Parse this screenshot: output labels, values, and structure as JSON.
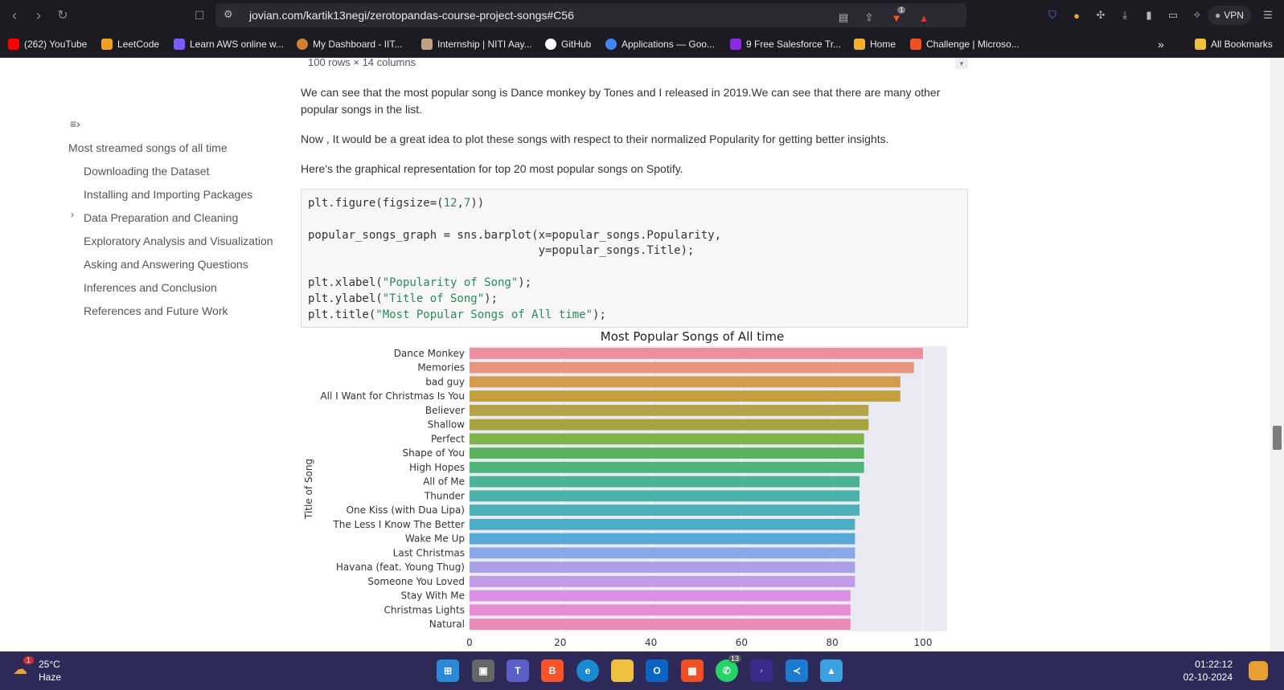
{
  "browser": {
    "url": "jovian.com/kartik13negi/zerotopandas-course-project-songs#C56",
    "vpn_label": "VPN",
    "shield_badge": "1"
  },
  "bookmarks": [
    {
      "label": "(262) YouTube",
      "color": "#ff0000"
    },
    {
      "label": "LeetCode",
      "color": "#f0a020"
    },
    {
      "label": "Learn AWS online w...",
      "color": "#7a5cff"
    },
    {
      "label": "My Dashboard - IIT...",
      "color": "#d08030"
    },
    {
      "label": "Internship | NITI Aay...",
      "color": "#c0a080"
    },
    {
      "label": "GitHub",
      "color": "#ffffff"
    },
    {
      "label": "Applications — Goo...",
      "color": "#4285f4"
    },
    {
      "label": "9 Free Salesforce Tr...",
      "color": "#8a2be2"
    },
    {
      "label": "Home",
      "color": "#f0b030"
    },
    {
      "label": "Challenge | Microso...",
      "color": "#f25022"
    }
  ],
  "bookmarks_more": "»",
  "all_bookmarks": "All Bookmarks",
  "toc": {
    "title": "Most streamed songs of all time",
    "items": [
      "Downloading the Dataset",
      "Installing and Importing Packages",
      "Data Preparation and Cleaning",
      "Exploratory Analysis and Visualization",
      "Asking and Answering Questions",
      "Inferences and Conclusion",
      "References and Future Work"
    ]
  },
  "content": {
    "truncated_note": "100 rows × 14 columns",
    "para1": "We can see that the most popular song is Dance monkey by Tones and I released in 2019.We can see that there are many other popular songs in the list.",
    "para2": "Now , It would be a great idea to plot these songs with respect to their normalized Popularity for getting better insights.",
    "para3": "Here's the graphical representation for top 20 most popular songs on Spotify."
  },
  "code": {
    "l1a": "plt.figure(figsize=(",
    "l1b": "12",
    "l1c": ",",
    "l1d": "7",
    "l1e": "))",
    "l2": "popular_songs_graph = sns.barplot(x=popular_songs.Popularity,",
    "l3": "                                  y=popular_songs.Title);",
    "l4a": "plt.xlabel(",
    "l4b": "\"Popularity of Song\"",
    "l4c": ");",
    "l5a": "plt.ylabel(",
    "l5b": "\"Title of Song\"",
    "l5c": ");",
    "l6a": "plt.title(",
    "l6b": "\"Most Popular Songs of All time\"",
    "l6c": ");"
  },
  "chart_data": {
    "type": "bar",
    "orientation": "horizontal",
    "title": "Most Popular Songs of All time",
    "xlabel": "",
    "ylabel": "Title of Song",
    "xlim": [
      0,
      100
    ],
    "xticks": [
      0,
      20,
      40,
      60,
      80,
      100
    ],
    "categories": [
      "Dance Monkey",
      "Memories",
      "bad guy",
      "All I Want for Christmas Is You",
      "Believer",
      "Shallow",
      "Perfect",
      "Shape of You",
      "High Hopes",
      "All of Me",
      "Thunder",
      "One Kiss (with Dua Lipa)",
      "The Less I Know The Better",
      "Wake Me Up",
      "Last Christmas",
      "Havana (feat. Young Thug)",
      "Someone You Loved",
      "Stay With Me",
      "Christmas Lights",
      "Natural"
    ],
    "values": [
      100,
      98,
      95,
      95,
      88,
      88,
      87,
      87,
      87,
      86,
      86,
      86,
      85,
      85,
      85,
      85,
      85,
      84,
      84,
      84
    ],
    "colors": [
      "#eb909c",
      "#e8957e",
      "#d49a4e",
      "#c59e3e",
      "#b5a24a",
      "#a7a540",
      "#7fb24a",
      "#55b45c",
      "#4db47c",
      "#4bb39a",
      "#4ab2a8",
      "#4cb0b8",
      "#4eadc6",
      "#55a8d8",
      "#8aa7e8",
      "#a9a0ea",
      "#c39aea",
      "#dc8fe6",
      "#e68cd0",
      "#e98ab8"
    ],
    "grid": true
  },
  "taskbar": {
    "temp": "25°C",
    "condition": "Haze",
    "weather_badge": "1",
    "time": "01:22:12",
    "date": "02-10-2024",
    "whatsapp_badge": "13"
  }
}
